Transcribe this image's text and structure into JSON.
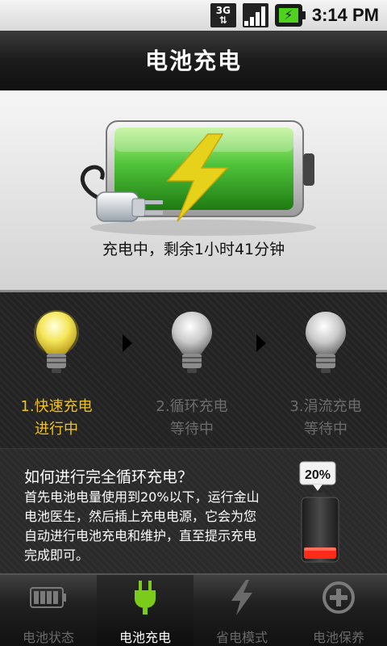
{
  "status_bar": {
    "network": "3G",
    "time": "3:14 PM"
  },
  "header": {
    "title": "电池充电"
  },
  "battery": {
    "status_text": "充电中，剩余1小时41分钟",
    "colors": {
      "fill": "#4fc33a",
      "bolt": "#e6d21a"
    }
  },
  "stages": [
    {
      "label_line1": "1.快速充电",
      "label_line2": "进行中",
      "state": "active"
    },
    {
      "label_line1": "2.循环充电",
      "label_line2": "等待中",
      "state": "waiting"
    },
    {
      "label_line1": "3.涓流充电",
      "label_line2": "等待中",
      "state": "waiting"
    }
  ],
  "tips": {
    "title": "如何进行完全循环充电？",
    "body": "首先电池电量使用到20%以下，运行金山电池医生，然后插上充电电源，它会为您自动进行电池充电和维护，直至提示充电完成即可。",
    "badge": "20%"
  },
  "tabs": [
    {
      "label": "电池状态",
      "icon": "battery-status-icon",
      "active": false
    },
    {
      "label": "电池充电",
      "icon": "plug-icon",
      "active": true
    },
    {
      "label": "省电模式",
      "icon": "lightning-icon",
      "active": false
    },
    {
      "label": "电池保养",
      "icon": "plus-circle-icon",
      "active": false
    }
  ]
}
